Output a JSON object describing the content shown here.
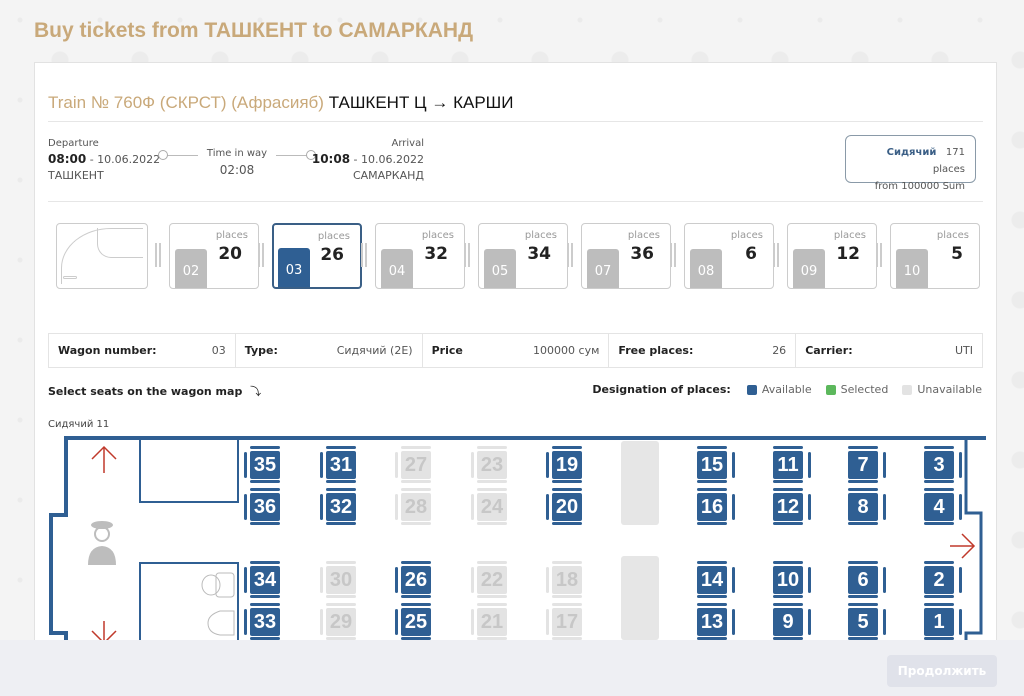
{
  "page": {
    "title": "Buy tickets from ТАШКЕНТ to САМАРКАНД"
  },
  "train": {
    "title_prefix": "Train № 760Ф (СКРСТ) (Афрасияб)",
    "route": "ТАШКЕНТ Ц → КАРШИ",
    "departure": {
      "label": "Departure",
      "time": "08:00",
      "date": "- 10.06.2022",
      "station": "ТАШКЕНТ"
    },
    "time_in_way": {
      "label": "Time in way",
      "value": "02:08"
    },
    "arrival": {
      "label": "Arrival",
      "time": "10:08",
      "date": "- 10.06.2022",
      "station": "САМАРКАНД"
    }
  },
  "class_summary": {
    "class_name": "Сидячий",
    "places": "171 places",
    "price": "from 100000 Sum"
  },
  "wagons": [
    {
      "number": "02",
      "places_label": "places",
      "places": "20",
      "active": false
    },
    {
      "number": "03",
      "places_label": "places",
      "places": "26",
      "active": true
    },
    {
      "number": "04",
      "places_label": "places",
      "places": "32",
      "active": false
    },
    {
      "number": "05",
      "places_label": "places",
      "places": "34",
      "active": false
    },
    {
      "number": "07",
      "places_label": "places",
      "places": "36",
      "active": false
    },
    {
      "number": "08",
      "places_label": "places",
      "places": "6",
      "active": false
    },
    {
      "number": "09",
      "places_label": "places",
      "places": "12",
      "active": false
    },
    {
      "number": "10",
      "places_label": "places",
      "places": "5",
      "active": false
    }
  ],
  "wagon_info": {
    "wagon_number": {
      "label": "Wagon number:",
      "value": "03"
    },
    "type": {
      "label": "Type:",
      "value": "Сидячий (2E)"
    },
    "price": {
      "label": "Price",
      "value": "100000 сум"
    },
    "free_places": {
      "label": "Free places:",
      "value": "26"
    },
    "carrier": {
      "label": "Carrier:",
      "value": "UTI"
    }
  },
  "hint": "Select seats on the wagon map",
  "legend": {
    "title": "Designation of places:",
    "items": [
      {
        "label": "Available",
        "color": "#2f5f93"
      },
      {
        "label": "Selected",
        "color": "#5cb85c"
      },
      {
        "label": "Unavailable",
        "color": "#e3e3e3"
      }
    ]
  },
  "car_label": "Сидячий 11",
  "seats": [
    {
      "n": "35",
      "s": "avail"
    },
    {
      "n": "36",
      "s": "avail"
    },
    {
      "n": "34",
      "s": "avail"
    },
    {
      "n": "33",
      "s": "avail"
    },
    {
      "n": "31",
      "s": "avail"
    },
    {
      "n": "32",
      "s": "avail"
    },
    {
      "n": "30",
      "s": "unavail"
    },
    {
      "n": "29",
      "s": "unavail"
    },
    {
      "n": "27",
      "s": "unavail"
    },
    {
      "n": "28",
      "s": "unavail"
    },
    {
      "n": "26",
      "s": "avail"
    },
    {
      "n": "25",
      "s": "avail"
    },
    {
      "n": "23",
      "s": "unavail"
    },
    {
      "n": "24",
      "s": "unavail"
    },
    {
      "n": "22",
      "s": "unavail"
    },
    {
      "n": "21",
      "s": "unavail"
    },
    {
      "n": "19",
      "s": "avail"
    },
    {
      "n": "20",
      "s": "avail"
    },
    {
      "n": "18",
      "s": "unavail"
    },
    {
      "n": "17",
      "s": "unavail"
    },
    {
      "n": "15",
      "s": "avail"
    },
    {
      "n": "16",
      "s": "avail"
    },
    {
      "n": "14",
      "s": "avail"
    },
    {
      "n": "13",
      "s": "avail"
    },
    {
      "n": "11",
      "s": "avail"
    },
    {
      "n": "12",
      "s": "avail"
    },
    {
      "n": "10",
      "s": "avail"
    },
    {
      "n": "9",
      "s": "avail"
    },
    {
      "n": "7",
      "s": "avail"
    },
    {
      "n": "8",
      "s": "avail"
    },
    {
      "n": "6",
      "s": "avail"
    },
    {
      "n": "5",
      "s": "avail"
    },
    {
      "n": "3",
      "s": "avail"
    },
    {
      "n": "4",
      "s": "avail"
    },
    {
      "n": "2",
      "s": "avail"
    },
    {
      "n": "1",
      "s": "avail"
    }
  ],
  "footer": {
    "continue_label": "Продолжить"
  }
}
